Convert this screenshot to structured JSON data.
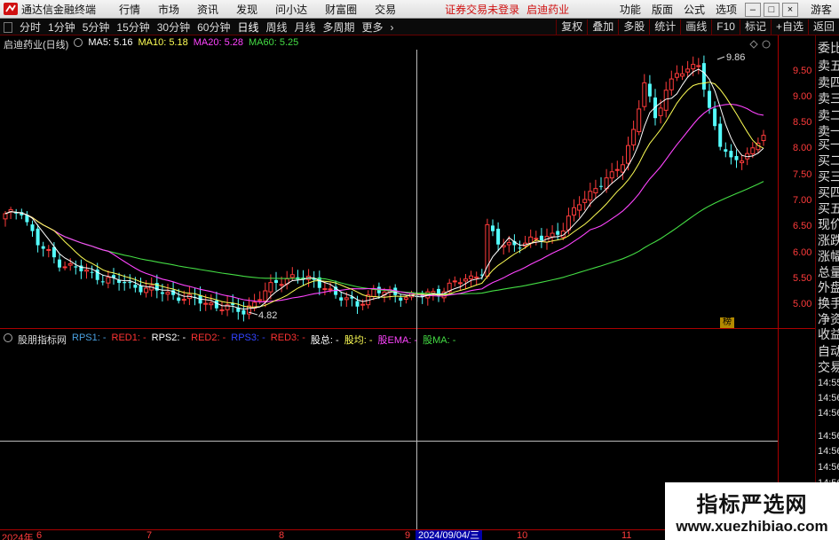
{
  "menubar": {
    "app_title": "通达信金融终端",
    "menus": [
      "行情",
      "市场",
      "资讯",
      "发现",
      "问小达",
      "财富圈",
      "交易"
    ],
    "warning": "证券交易未登录",
    "stock_title": "启迪药业",
    "right_menus": [
      "功能",
      "版面",
      "公式",
      "选项"
    ],
    "guest": "游客",
    "colors": {
      "warning": "#d01010"
    }
  },
  "toolbar": {
    "periods": [
      "分时",
      "1分钟",
      "5分钟",
      "15分钟",
      "30分钟",
      "60分钟",
      "日线",
      "周线",
      "月线",
      "多周期",
      "更多"
    ],
    "active_period": "日线",
    "right_tools": [
      "复权",
      "叠加",
      "多股",
      "统计",
      "画线",
      "F10",
      "标记",
      "+自选",
      "返回"
    ]
  },
  "main_legend": {
    "symbol": "启迪药业(日线)",
    "ma5": "MA5: 5.16",
    "ma10": "MA10: 5.18",
    "ma20": "MA20: 5.28",
    "ma60": "MA60: 5.25",
    "colors": {
      "ma5": "#ffffff",
      "ma10": "#ffff55",
      "ma20": "#ff44ff",
      "ma60": "#44dd44"
    }
  },
  "price_axis": [
    "9.50",
    "9.00",
    "8.50",
    "8.00",
    "7.50",
    "7.00",
    "6.50",
    "6.00",
    "5.50",
    "5.00"
  ],
  "annotations": {
    "high": "9.86",
    "low": "4.82",
    "bang": "榜"
  },
  "quote_panel": {
    "labels": [
      "委比",
      "卖五",
      "卖四",
      "卖三",
      "卖二",
      "卖一",
      "买一",
      "买二",
      "买三",
      "买四",
      "买五",
      "现价",
      "涨跌",
      "涨幅",
      "总量",
      "外盘",
      "换手",
      "净资",
      "收益"
    ],
    "auto_trade": [
      "自动",
      "交易"
    ],
    "times": [
      "14:55",
      "14:56",
      "14:56",
      "14:56",
      "14:56",
      "14:56",
      "14:56"
    ]
  },
  "indicator_legend": {
    "name": "股朋指标网",
    "items": [
      {
        "label": "RPS1: -",
        "color": "#4aa0e0"
      },
      {
        "label": "RED1: -",
        "color": "#ff3333"
      },
      {
        "label": "RPS2: -",
        "color": "#ffffff"
      },
      {
        "label": "RED2: -",
        "color": "#ff3333"
      },
      {
        "label": "RPS3: -",
        "color": "#3344ff"
      },
      {
        "label": "RED3: -",
        "color": "#ff3333"
      },
      {
        "label": "股总: -",
        "color": "#ffffff"
      },
      {
        "label": "股均: -",
        "color": "#ffff55"
      },
      {
        "label": "股EMA: -",
        "color": "#ff44ff"
      },
      {
        "label": "股MA: -",
        "color": "#44dd44"
      }
    ]
  },
  "date_bar": {
    "labels": [
      "2024年",
      "6",
      "7",
      "8",
      "9",
      "10",
      "11"
    ],
    "cross_date": "2024/09/04/三"
  },
  "watermark": {
    "title": "指标严选网",
    "url": "www.xuezhibiao.com"
  },
  "colors": {
    "up": "#ff3b3b",
    "down": "#54ffff",
    "axis": "#aa0000"
  }
}
